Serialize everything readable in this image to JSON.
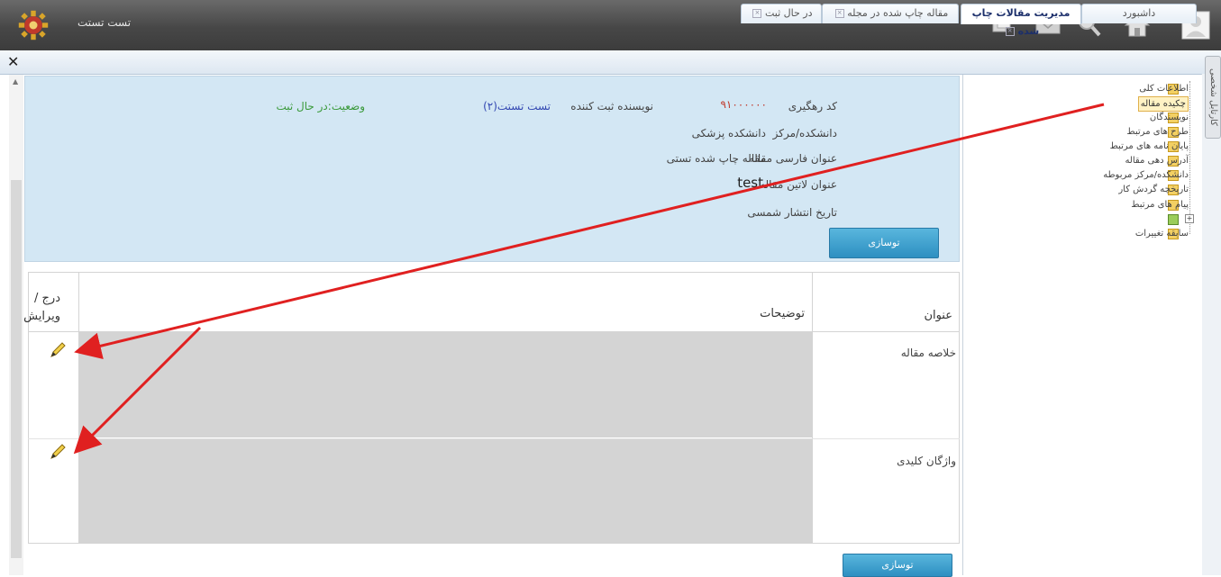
{
  "app": {
    "title": "تست تستت"
  },
  "toolbar_icons": [
    "windows-icon",
    "mail-icon",
    "search-icon",
    "home-icon",
    "user-avatar-icon"
  ],
  "tabs": [
    {
      "label": "داشبورد"
    },
    {
      "label": "مدیریت مقالات چاپ شده"
    },
    {
      "label": "مقاله چاپ شده در مجله"
    },
    {
      "label": "در حال ثبت"
    }
  ],
  "side_tab": {
    "label": "کارتابل شخصی"
  },
  "tree": {
    "items": [
      "اطلاعات کلی",
      "چکیده مقاله",
      "نویسندگان",
      "طرح های مرتبط",
      "پایان نامه های مرتبط",
      "آدرس دهی مقاله",
      "دانشکده/مرکز مربوطه",
      "تاریخچه گردش کار",
      "پیام های مرتبط",
      "سابقه تغییرات"
    ],
    "selected_index": 1
  },
  "info": {
    "tracking_code_label": "کد رهگیری",
    "tracking_code": "۹۱۰۰۰۰۰۰",
    "author_label": "نویسنده ثبت کننده",
    "author_value": "تست تستت(۲)",
    "status_label": "وضعیت:در حال ثبت",
    "faculty_label": "دانشکده/مرکز",
    "faculty_value": "دانشکده پزشکی",
    "persian_title_label": "عنوان فارسی مقاله",
    "persian_title_value": "مقاله چاپ شده تستی",
    "latin_title_label": "عنوان لاتین مقاله",
    "latin_title_value": "test",
    "publish_date_label": "تاریخ انتشار شمسی",
    "button_label": "توسازی"
  },
  "grid": {
    "headers": {
      "title": "عنوان",
      "description": "توضیحات",
      "edit": "درج / ویرایش"
    },
    "rows": [
      {
        "title": "خلاصه مقاله"
      },
      {
        "title": "واژگان کلیدی"
      }
    ],
    "button_label": "توسازی"
  },
  "colors": {
    "info_bg": "#d3e7f4",
    "button": "#3a9bcc",
    "arrow": "#e02020",
    "selected_tree": "#fff2c4"
  }
}
